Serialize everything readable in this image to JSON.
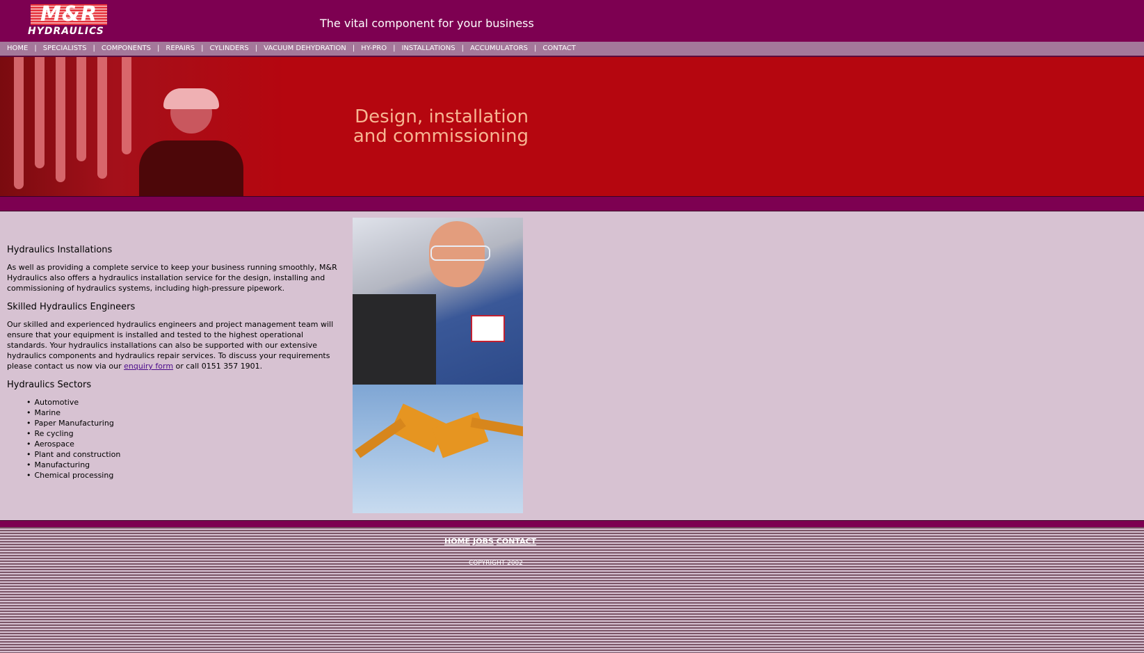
{
  "header": {
    "logo_mr": "M&R",
    "logo_text": "HYDRAULICS",
    "tagline": "The vital component for your business"
  },
  "nav": {
    "items": [
      {
        "label": "HOME"
      },
      {
        "label": "SPECIALISTS"
      },
      {
        "label": "COMPONENTS"
      },
      {
        "label": "REPAIRS"
      },
      {
        "label": "CYLINDERS"
      },
      {
        "label": "VACUUM DEHYDRATION"
      },
      {
        "label": "HY-PRO"
      },
      {
        "label": "INSTALLATIONS"
      },
      {
        "label": "ACCUMULATORS"
      },
      {
        "label": "CONTACT"
      }
    ],
    "separator": "|"
  },
  "banner": {
    "line1": "Design, installation",
    "line2": "and commissioning"
  },
  "content": {
    "heading1": "Hydraulics Installations",
    "para1": "As well as providing a complete service to keep your business running smoothly, M&R Hydraulics also offers a hydraulics installation service for the design, installing and commissioning of hydraulics systems, including high-pressure pipework.",
    "heading2": "Skilled Hydraulics Engineers",
    "para2_before": "Our skilled and experienced hydraulics engineers and project management team will ensure that your equipment is installed and tested to the highest operational standards. Your hydraulics installations can also be supported with our extensive hydraulics components and hydraulics repair services. To discuss your requirements please contact us now via our ",
    "para2_link": "enquiry form",
    "para2_after": " or call 0151 357 1901.",
    "heading3": "Hydraulics Sectors",
    "sectors": [
      "Automotive",
      "Marine",
      "Paper Manufacturing",
      "Re cycling",
      "Aerospace",
      "Plant and construction",
      "Manufacturing",
      "Chemical processing"
    ]
  },
  "footer": {
    "links": [
      {
        "label": "HOME"
      },
      {
        "label": "JOBS"
      },
      {
        "label": "CONTACT"
      }
    ],
    "copyright": "COPYRIGHT 2002"
  },
  "colors": {
    "header_bg": "#7d0051",
    "nav_bg": "#a4789a",
    "banner_bg": "#b5060f",
    "content_bg": "#d7c2d2",
    "banner_text": "#f7b592"
  }
}
